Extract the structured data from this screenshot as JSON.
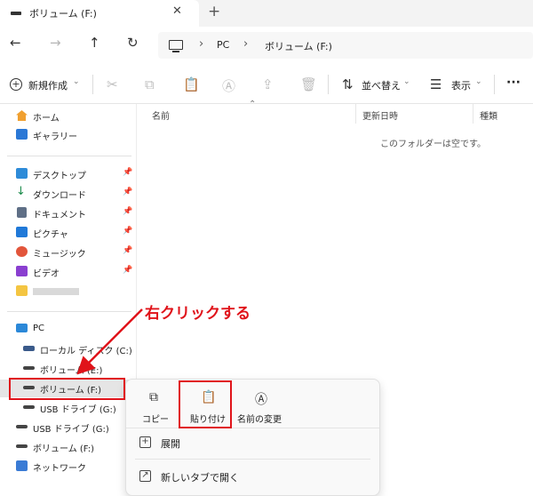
{
  "tab": {
    "title": "ボリューム (F:)",
    "close": "✕",
    "new": "+"
  },
  "nav": {
    "back": "←",
    "forward": "→",
    "up": "↑",
    "refresh": "↻"
  },
  "address": {
    "sep": "›",
    "segments": [
      "PC",
      "ボリューム (F:)"
    ]
  },
  "toolbar": {
    "new_icon": "+",
    "new_label": "新規作成",
    "chev": "⌄",
    "sort_label": "並べ替え",
    "view_label": "表示",
    "more": "···",
    "icons": {
      "cut": "✂",
      "copy": "⧉",
      "paste": "📋",
      "rename": "Ⓐ",
      "share": "⇪",
      "delete": "🗑",
      "sort": "⇅",
      "view": "☰"
    }
  },
  "sidebar": {
    "pin": "📌",
    "home": "ホーム",
    "gallery": "ギャラリー",
    "desktop": "デスクトップ",
    "downloads": "ダウンロード",
    "documents": "ドキュメント",
    "pictures": "ピクチャ",
    "music": "ミュージック",
    "videos": "ビデオ",
    "pc": "PC",
    "local_disk": "ローカル ディスク (C:)",
    "volume_e": "ボリューム (E:)",
    "volume_f": "ボリューム (F:)",
    "usb_g": "USB ドライブ (G:)",
    "usb_g2": "USB ドライブ (G:)",
    "volume_f2": "ボリューム (F:)",
    "network": "ネットワーク"
  },
  "content": {
    "sort_indicator": "⌃",
    "col_name": "名前",
    "col_date": "更新日時",
    "col_type": "種類",
    "empty_message": "このフォルダーは空です。"
  },
  "menu": {
    "copy_icon": "⧉",
    "copy_label": "コピー",
    "paste_icon": "📋",
    "paste_label": "貼り付け",
    "rename_icon": "Ⓐ",
    "rename_label": "名前の変更",
    "expand_icon": "+",
    "expand_label": "展開",
    "new_tab_icon": "↗",
    "new_tab_label": "新しいタブで開く"
  },
  "annotation": {
    "text": "右クリックする",
    "color": "#e0131a"
  }
}
